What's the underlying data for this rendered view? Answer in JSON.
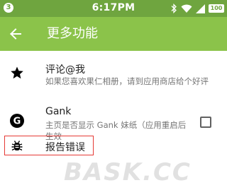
{
  "status_bar": {
    "badge": "3",
    "time": "6:17PM",
    "battery": "100",
    "icons": [
      "bluetooth-icon",
      "wifi-icon",
      "signal-icon",
      "battery-icon"
    ]
  },
  "toolbar": {
    "title": "更多功能",
    "back_icon": "arrow-back-icon"
  },
  "items": [
    {
      "icon": "star-icon",
      "title": "评论@我",
      "subtitle": "如果您喜欢果仁相册，请到应用商店给个好评"
    },
    {
      "icon": "gank-g-icon",
      "title": "Gank",
      "subtitle_line1": "主页是否显示 Gank 妹纸（应用重启后",
      "subtitle_line2": "生效",
      "checked": false
    },
    {
      "icon": "bug-icon",
      "title": "报告错误"
    }
  ],
  "watermark": "BASK.CC",
  "colors": {
    "status_bar": "#6fa53f",
    "toolbar": "#8bc34a",
    "highlight": "#e53935"
  }
}
